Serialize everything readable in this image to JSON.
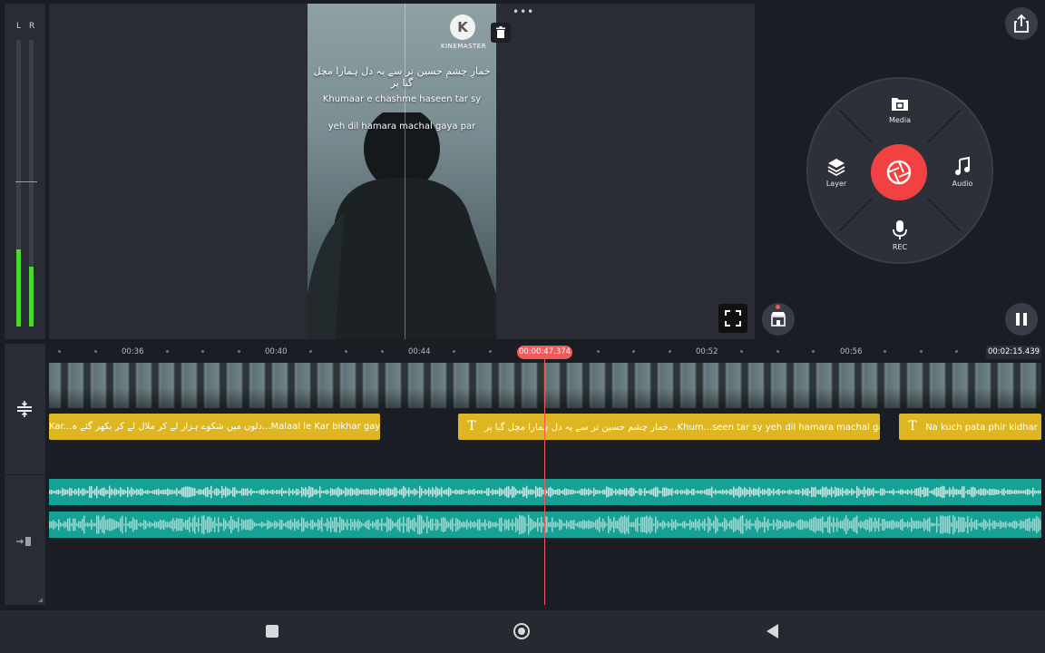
{
  "meter": {
    "left_label": "L",
    "right_label": "R",
    "left_level": 0.27,
    "right_level": 0.21
  },
  "preview": {
    "caption_urdu": "خمارِ چشمِ حسین تر سے یہ دل ہمارا مچل گیا پر",
    "caption_line1": "Khumaar e chashme haseen tar sy",
    "caption_line2": "yeh dil hamara machal gaya par",
    "logo_letter": "K",
    "logo_text": "KINEMASTER"
  },
  "wheel": {
    "media_label": "Media",
    "audio_label": "Audio",
    "layer_label": "Layer",
    "rec_label": "REC"
  },
  "timeline": {
    "ruler_labels": [
      "00:36",
      "00:40",
      "00:44",
      "00:52",
      "00:56"
    ],
    "current_time": "00:00:47.374",
    "end_time": "00:02:15.439",
    "playhead_fraction": 0.5,
    "text_clips": [
      {
        "text": "Kar...دلوں میں شکوے ہزار لے کر ملال لے کر بکھر گئے ہ...Malaal le Kar bikhar gaye hum",
        "has_icon": false
      },
      {
        "text": "خمار چشم حسین تر سے یہ دل ہمارا مچل گیا پر...Khum...seen tar sy yeh dil hamara machal gaya par",
        "has_icon": true
      },
      {
        "text": "Na kuch pata phir kidhar",
        "has_icon": true
      }
    ]
  },
  "icons": {
    "share": "share-icon",
    "trash": "trash-icon",
    "fullscreen": "fullscreen-icon",
    "store": "store-icon",
    "pause": "pause-icon",
    "media": "media-icon",
    "audio": "music-note-icon",
    "layer": "layers-icon",
    "rec": "microphone-icon",
    "capture": "camera-shutter-icon",
    "track_adjust": "track-height-icon",
    "track_mute": "audio-track-icon",
    "nav_recents": "square-icon",
    "nav_home": "circle-icon",
    "nav_back": "triangle-back-icon"
  },
  "colors": {
    "accent": "#f24141",
    "text_clip": "#ddb622",
    "audio_clip": "#16a195",
    "meter": "#4ad82c"
  }
}
